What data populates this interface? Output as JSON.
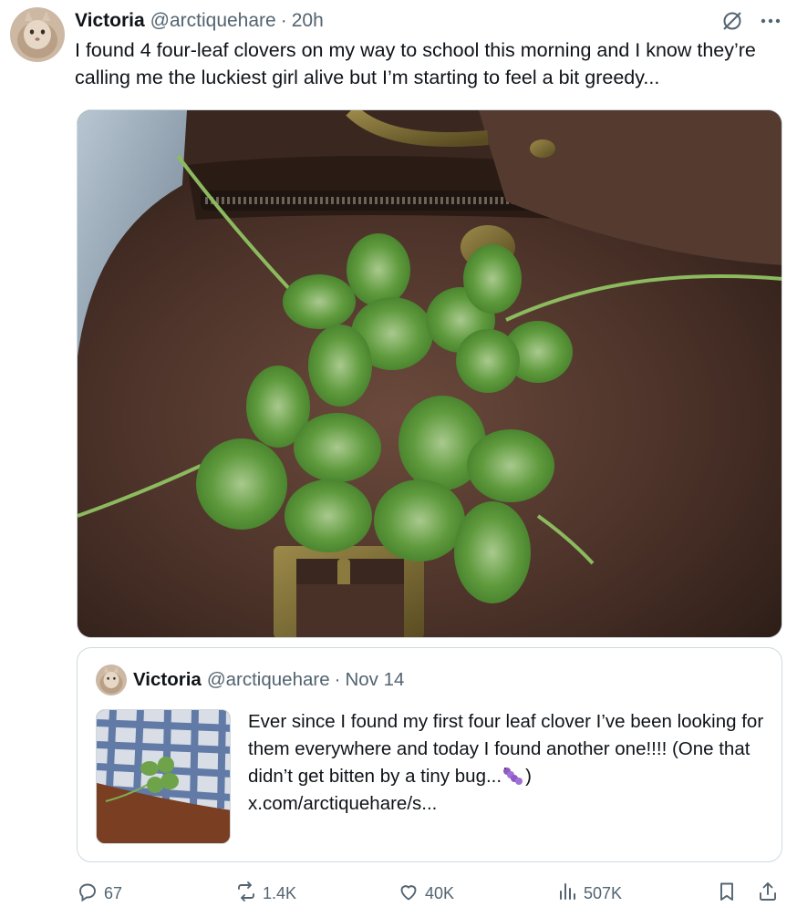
{
  "tweet": {
    "author_name": "Victoria",
    "author_handle": "@arctiquehare",
    "separator": "·",
    "time": "20h",
    "text": "I found 4 four-leaf clovers on my way to school this morning and I know they’re calling me the luckiest girl alive but I’m starting to feel a bit greedy..."
  },
  "quote": {
    "author_name": "Victoria",
    "author_handle": "@arctiquehare",
    "separator": "·",
    "date": "Nov 14",
    "text": "Ever since I found my first four leaf clover I’ve been looking for them everywhere and today I found another one!!!! (One that didn’t get bitten by a tiny bug...",
    "text_end": ")",
    "link": "x.com/arctiquehare/s..."
  },
  "actions": {
    "replies": "67",
    "reposts": "1.4K",
    "likes": "40K",
    "views": "507K"
  },
  "icons": {
    "reply": "reply-icon",
    "repost": "repost-icon",
    "like": "heart-icon",
    "views": "views-icon",
    "bookmark": "bookmark-icon",
    "share": "share-icon",
    "grok": "grok-icon",
    "more": "more-icon"
  },
  "colors": {
    "text": "#0f1419",
    "secondary": "#536471",
    "border": "#cfd9de"
  }
}
